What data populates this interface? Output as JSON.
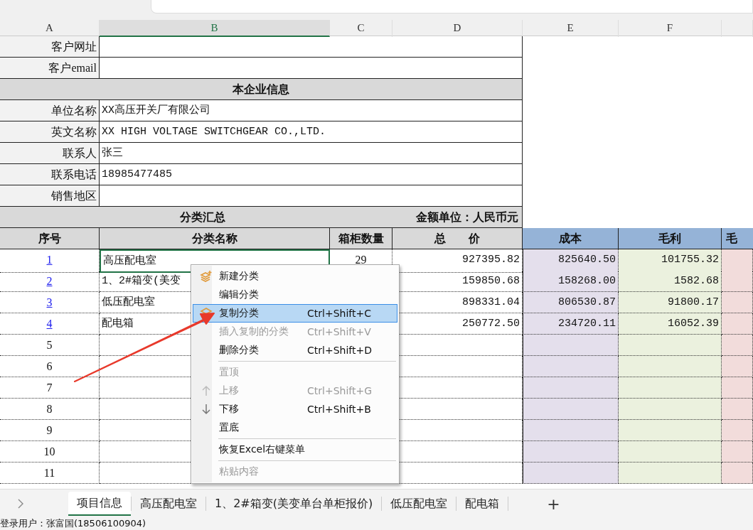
{
  "columns": [
    {
      "label": "A",
      "selected": false
    },
    {
      "label": "B",
      "selected": true
    },
    {
      "label": "C",
      "selected": false
    },
    {
      "label": "D",
      "selected": false
    },
    {
      "label": "E",
      "selected": false
    },
    {
      "label": "F",
      "selected": false
    }
  ],
  "customer_rows": [
    {
      "label": "客户网址"
    },
    {
      "label": "客户email"
    }
  ],
  "company_header": "本企业信息",
  "company_rows": [
    {
      "label": "单位名称",
      "value": "XX高压开关厂有限公司"
    },
    {
      "label": "英文名称",
      "value": "XX HIGH VOLTAGE SWITCHGEAR CO.,LTD."
    },
    {
      "label": "联系人",
      "value": "张三"
    },
    {
      "label": "联系电话",
      "value": "18985477485"
    },
    {
      "label": "销售地区"
    }
  ],
  "summary": {
    "title": "分类汇总",
    "unit": "金额单位：人民币元"
  },
  "table": {
    "columns": [
      "序号",
      "分类名称",
      "箱柜数量",
      "总　　价",
      "成本",
      "毛利",
      "毛"
    ],
    "rows": [
      {
        "index": "1",
        "name": "高压配电室",
        "count": "29",
        "total": "927395.82",
        "cost": "825640.50",
        "profit": "101755.32",
        "selected": true
      },
      {
        "index": "2",
        "name": "1、2#箱变(美变",
        "total": "159850.68",
        "cost": "158268.00",
        "profit": "1582.68",
        "selected": false
      },
      {
        "index": "3",
        "name": "低压配电室",
        "total": "898331.04",
        "cost": "806530.87",
        "profit": "91800.17",
        "selected": false
      },
      {
        "index": "4",
        "name": "配电箱",
        "total": "250772.50",
        "cost": "234720.11",
        "profit": "16052.39",
        "selected": false
      }
    ],
    "empty_rows": [
      "5",
      "6",
      "7",
      "8",
      "9",
      "10",
      "11"
    ]
  },
  "context_menu": [
    {
      "kind": "item",
      "label": "新建分类",
      "disabled": false,
      "selected": false
    },
    {
      "kind": "item",
      "label": "编辑分类",
      "disabled": false,
      "selected": false
    },
    {
      "kind": "item",
      "label": "复制分类",
      "shortcut": "Ctrl+Shift+C",
      "disabled": false,
      "selected": true
    },
    {
      "kind": "item",
      "label": "插入复制的分类",
      "shortcut": "Ctrl+Shift+V",
      "disabled": true,
      "selected": false
    },
    {
      "kind": "item",
      "label": "删除分类",
      "shortcut": "Ctrl+Shift+D",
      "disabled": false,
      "selected": false
    },
    {
      "kind": "separator"
    },
    {
      "kind": "item",
      "label": "置顶",
      "disabled": true,
      "selected": false
    },
    {
      "kind": "item",
      "label": "上移",
      "shortcut": "Ctrl+Shift+G",
      "disabled": true,
      "selected": false
    },
    {
      "kind": "item",
      "label": "下移",
      "shortcut": "Ctrl+Shift+B",
      "disabled": false,
      "selected": false
    },
    {
      "kind": "item",
      "label": "置底",
      "disabled": false,
      "selected": false
    },
    {
      "kind": "separator"
    },
    {
      "kind": "item",
      "label": "恢复Excel右键菜单",
      "disabled": false,
      "selected": false
    },
    {
      "kind": "separator"
    },
    {
      "kind": "item",
      "label": "粘贴内容",
      "disabled": true,
      "selected": false
    }
  ],
  "sheet_tabs": [
    {
      "label": "项目信息",
      "selected": true
    },
    {
      "label": "高压配电室",
      "selected": false
    },
    {
      "label": "1、2#箱变(美变单台单柜报价)",
      "selected": false
    },
    {
      "label": "低压配电室",
      "selected": false
    },
    {
      "label": "配电箱",
      "selected": false
    }
  ],
  "add_sheet": "+",
  "status_bar": "登录用户：张富国(18506100904)"
}
